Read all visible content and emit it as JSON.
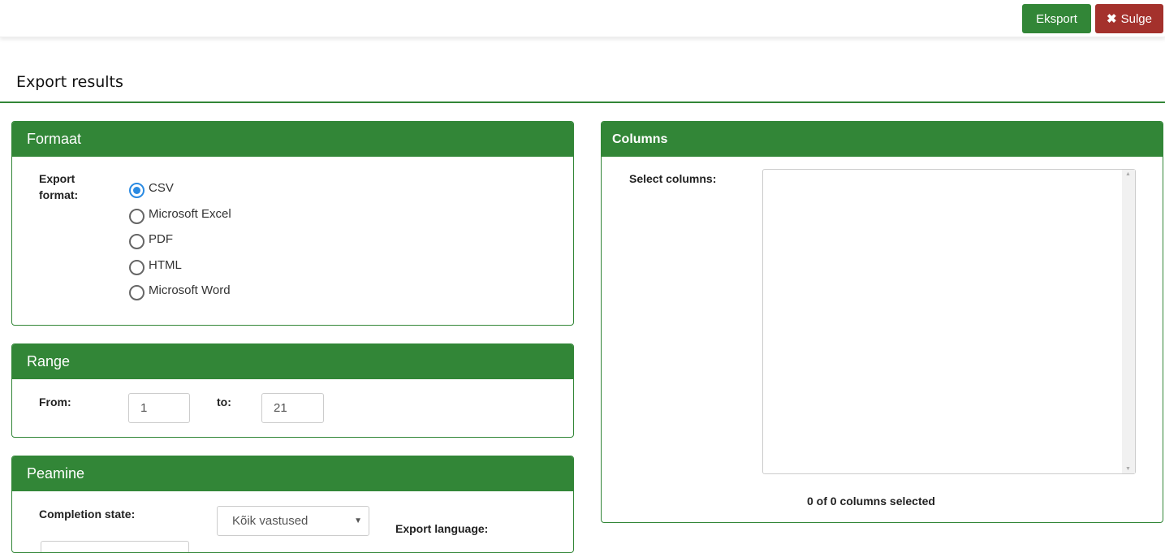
{
  "toolbar": {
    "export_label": "Eksport",
    "close_label": "Sulge",
    "close_icon": "times-icon"
  },
  "page_title": "Export results",
  "format": {
    "title": "Formaat",
    "label": "Export format:",
    "options": [
      "CSV",
      "Microsoft Excel",
      "PDF",
      "HTML",
      "Microsoft Word"
    ],
    "selected": "CSV"
  },
  "range": {
    "title": "Range",
    "from_label": "From:",
    "from_value": "1",
    "to_label": "to:",
    "to_value": "21"
  },
  "main": {
    "title": "Peamine",
    "completion_label": "Completion state:",
    "completion_value": "Kõik vastused",
    "language_label": "Export language:"
  },
  "columns": {
    "title": "Columns",
    "select_label": "Select columns:",
    "status": "0 of 0 columns selected"
  },
  "colors": {
    "primary": "#328637",
    "danger": "#a4312c",
    "radio": "#2a8ae2"
  }
}
